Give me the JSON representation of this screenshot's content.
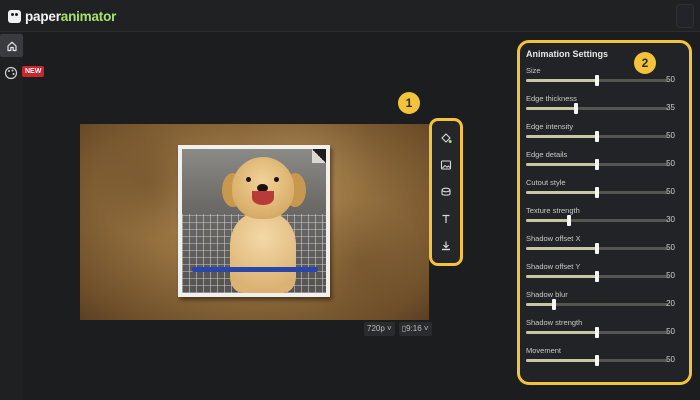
{
  "app": {
    "logo_part1": "paper",
    "logo_part2": "animator",
    "accent": "#a6e36a",
    "highlight": "#f3c33b"
  },
  "sidebar": {
    "badge": "NEW"
  },
  "toolbar": {
    "tools": [
      "fill-icon",
      "image-icon",
      "shape-icon",
      "text-icon",
      "download-icon"
    ]
  },
  "markers": {
    "one": "1",
    "two": "2"
  },
  "canvas_controls": {
    "resolution": "720p",
    "aspect": "9:16"
  },
  "panel": {
    "title": "Animation Settings",
    "settings": [
      {
        "label": "Size",
        "value": "50"
      },
      {
        "label": "Edge thickness",
        "value": "35"
      },
      {
        "label": "Edge intensity",
        "value": "50"
      },
      {
        "label": "Edge details",
        "value": "50"
      },
      {
        "label": "Cutout style",
        "value": "50"
      },
      {
        "label": "Texture strength",
        "value": "30"
      },
      {
        "label": "Shadow offset X",
        "value": "50"
      },
      {
        "label": "Shadow offset Y",
        "value": "50"
      },
      {
        "label": "Shadow blur",
        "value": "20"
      },
      {
        "label": "Shadow strength",
        "value": "50"
      },
      {
        "label": "Movement",
        "value": "50"
      }
    ]
  }
}
